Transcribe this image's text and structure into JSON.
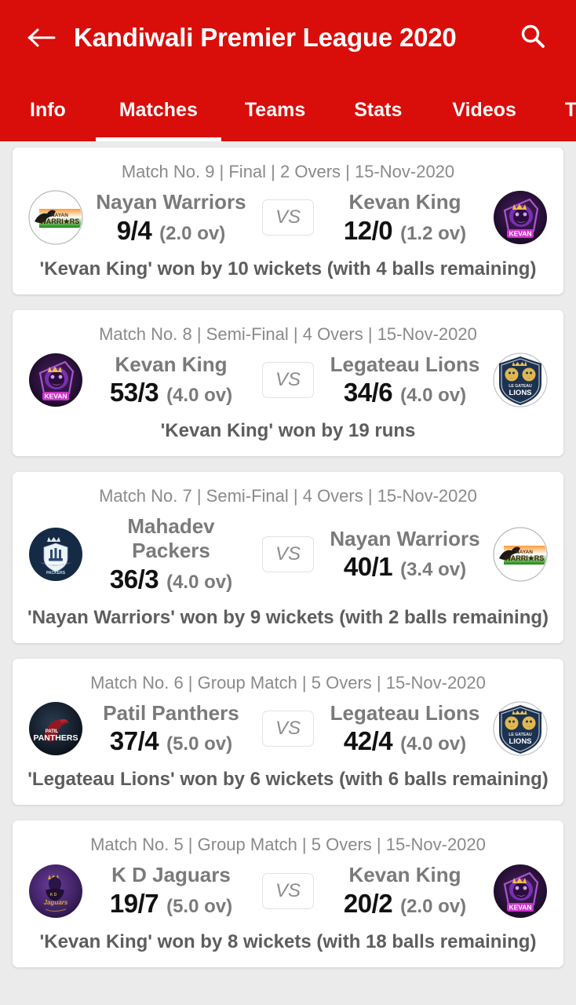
{
  "header": {
    "title": "Kandiwali Premier League 2020",
    "back_icon": "arrow-left-icon",
    "search_icon": "search-icon"
  },
  "tabs": [
    {
      "label": "Info",
      "active": false
    },
    {
      "label": "Matches",
      "active": true
    },
    {
      "label": "Teams",
      "active": false
    },
    {
      "label": "Stats",
      "active": false
    },
    {
      "label": "Videos",
      "active": false
    },
    {
      "label": "Tab",
      "active": false
    }
  ],
  "colors": {
    "brand_red": "#d90d09",
    "page_bg": "#ebebeb",
    "card_bg": "#ffffff",
    "muted_text": "#8a8a8a",
    "team_name": "#7a7a7a",
    "score": "#111111"
  },
  "vs_label": "VS",
  "matches": [
    {
      "meta": "Match No. 9 | Final | 2 Overs | 15-Nov-2020",
      "left": {
        "team": "Nayan Warriors",
        "score": "9/4",
        "overs": "(2.0 ov)",
        "logo": "nayan-warriors-logo"
      },
      "right": {
        "team": "Kevan King",
        "score": "12/0",
        "overs": "(1.2 ov)",
        "logo": "kevan-king-logo"
      },
      "result": "'Kevan King'  won by 10 wickets (with 4 balls remaining)"
    },
    {
      "meta": "Match No. 8 | Semi-Final | 4 Overs | 15-Nov-2020",
      "left": {
        "team": "Kevan King",
        "score": "53/3",
        "overs": "(4.0 ov)",
        "logo": "kevan-king-logo"
      },
      "right": {
        "team": "Legateau Lions",
        "score": "34/6",
        "overs": "(4.0 ov)",
        "logo": "legateau-lions-logo"
      },
      "result": "'Kevan King'  won by 19 runs"
    },
    {
      "meta": "Match No. 7 | Semi-Final | 4 Overs | 15-Nov-2020",
      "left": {
        "team": "Mahadev Packers",
        "score": "36/3",
        "overs": "(4.0 ov)",
        "logo": "mahadev-packers-logo"
      },
      "right": {
        "team": "Nayan Warriors",
        "score": "40/1",
        "overs": "(3.4 ov)",
        "logo": "nayan-warriors-logo"
      },
      "result": "'Nayan Warriors'  won by 9 wickets (with 2 balls remaining)"
    },
    {
      "meta": "Match No. 6 | Group Match | 5 Overs | 15-Nov-2020",
      "left": {
        "team": "Patil Panthers",
        "score": "37/4",
        "overs": "(5.0 ov)",
        "logo": "patil-panthers-logo"
      },
      "right": {
        "team": "Legateau Lions",
        "score": "42/4",
        "overs": "(4.0 ov)",
        "logo": "legateau-lions-logo"
      },
      "result": "'Legateau Lions'  won by 6 wickets (with 6 balls remaining)"
    },
    {
      "meta": "Match No. 5 | Group Match | 5 Overs | 15-Nov-2020",
      "left": {
        "team": "K D Jaguars",
        "score": "19/7",
        "overs": "(5.0 ov)",
        "logo": "kd-jaguars-logo"
      },
      "right": {
        "team": "Kevan King",
        "score": "20/2",
        "overs": "(2.0 ov)",
        "logo": "kevan-king-logo"
      },
      "result": "'Kevan King'  won by 8 wickets (with 18 balls remaining)"
    }
  ]
}
